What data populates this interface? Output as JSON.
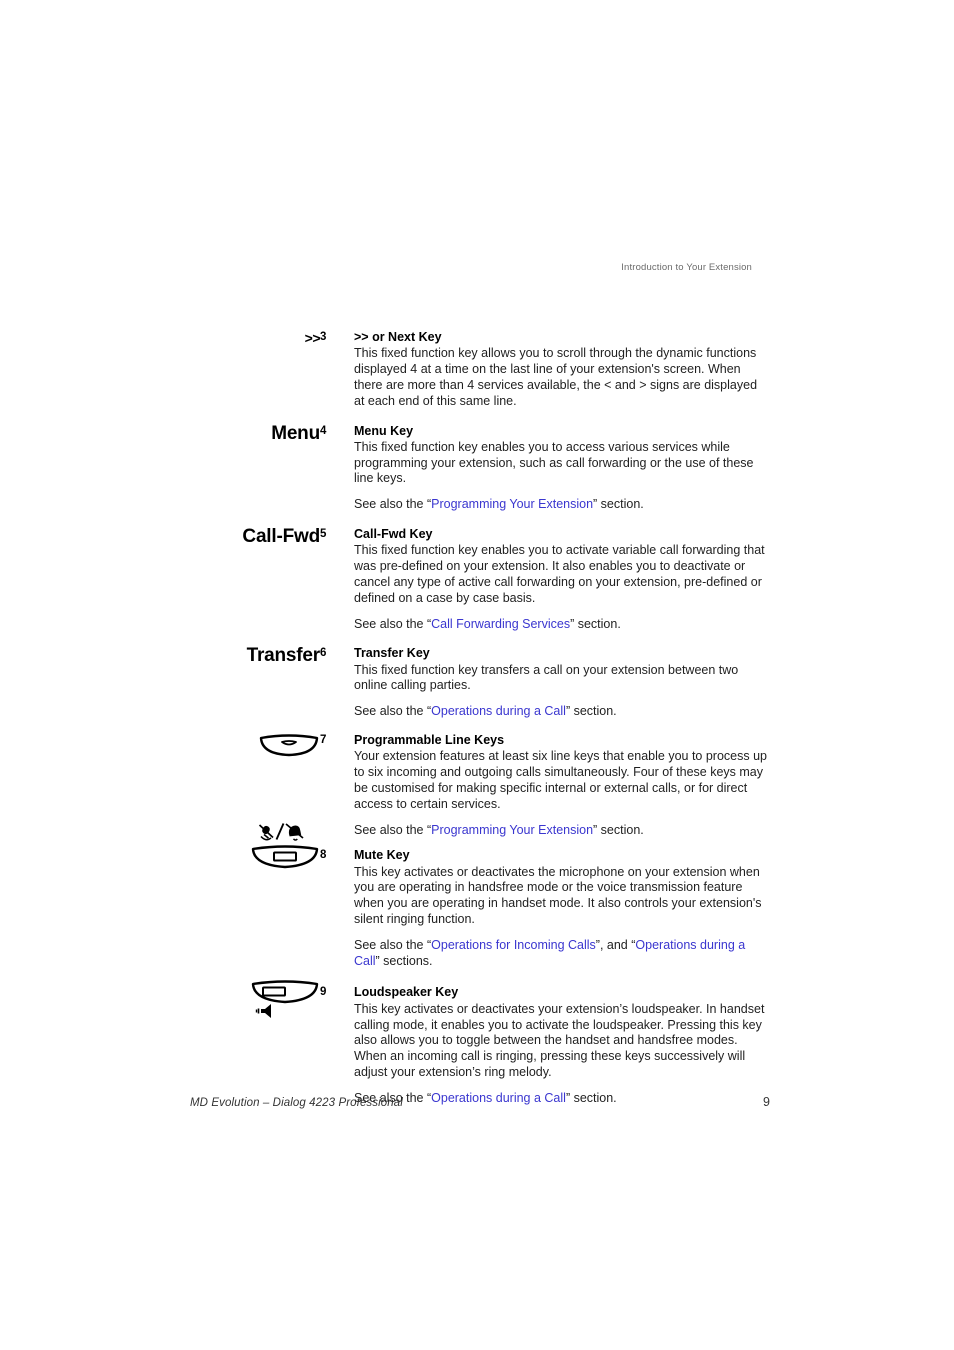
{
  "header": {
    "running_head": "Introduction to Your Extension"
  },
  "footer": {
    "document_title": "MD Evolution – Dialog 4223 Professional",
    "page_number": "9"
  },
  "colors": {
    "link": "#3a36cf",
    "text": "#1f1f1f",
    "running_head": "#6b6b6b"
  },
  "entries": [
    {
      "key_label": "&gt;&gt;",
      "key_icon": "none",
      "number": "3",
      "title": ">> or Next Key",
      "body": "This fixed function key allows you to scroll through the dynamic functions displayed 4 at a time on the last line of your extension's screen. When there are more than 4 services available, the < and > signs are displayed at each end of this same line.",
      "see_also_prefix": "",
      "see_also_links": [],
      "see_also_suffix": ""
    },
    {
      "key_label": "Menu",
      "key_icon": "none",
      "number": "4",
      "title": "Menu Key",
      "body": "This fixed function key enables you to access various services while programming your extension, such as call forwarding or the use of these line keys.",
      "see_also_prefix": "See also the “",
      "see_also_links": [
        "Programming Your Extension"
      ],
      "see_also_suffix": "” section."
    },
    {
      "key_label": "Call-Fwd",
      "key_icon": "none",
      "number": "5",
      "title": "Call-Fwd Key",
      "body": "This fixed function key enables you to activate variable call forwarding that was pre-defined on your extension. It also enables you to deactivate or cancel any type of active call forwarding on your extension, pre-defined or defined on a case by case basis.",
      "see_also_prefix": "See also the “",
      "see_also_links": [
        "Call Forwarding Services"
      ],
      "see_also_suffix": "” section."
    },
    {
      "key_label": "Transfer",
      "key_icon": "none",
      "number": "6",
      "title": "Transfer Key",
      "body": "This fixed function key transfers a call on your extension between two online calling parties.",
      "see_also_prefix": "See also the “",
      "see_also_links": [
        "Operations during a Call"
      ],
      "see_also_suffix": "” section."
    },
    {
      "key_label": "",
      "key_icon": "line-key-icon",
      "number": "7",
      "title": "Programmable Line Keys",
      "body": "Your extension features at least six line keys that enable you to process up to six incoming and outgoing calls simultaneously. Four of these keys may be customised for making specific internal or external calls, or for direct access to certain services.",
      "see_also_prefix": "See also the “",
      "see_also_links": [
        "Programming Your Extension"
      ],
      "see_also_suffix": "” section."
    },
    {
      "key_label": "",
      "key_icon": "mute-key-icon",
      "number": "8",
      "title": "Mute Key",
      "body": "This key activates or deactivates the microphone on your extension when you are operating in handsfree mode or the voice transmission feature when you are operating in handset mode. It also controls your extension's silent ringing function.",
      "see_also_prefix": "See also the “",
      "see_also_links": [
        "Operations for Incoming Calls",
        "Operations during a Call"
      ],
      "see_also_middle": "”, and “",
      "see_also_suffix": "” sections."
    },
    {
      "key_label": "",
      "key_icon": "loudspeaker-key-icon",
      "number": "9",
      "title": "Loudspeaker Key",
      "body": "This key activates or deactivates your extension’s loudspeaker. In handset calling mode, it enables you to activate the loudspeaker. Pressing this key also allows you to toggle between the handset and handsfree modes. When an incoming call is ringing, pressing these keys successively will adjust your extension’s ring melody.",
      "see_also_prefix": "See also the “",
      "see_also_links": [
        "Operations during a Call"
      ],
      "see_also_suffix": "” section."
    }
  ]
}
